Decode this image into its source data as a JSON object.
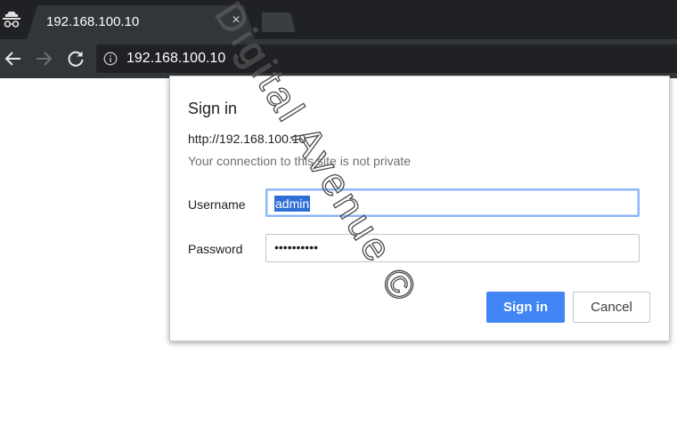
{
  "browser": {
    "tab": {
      "title": "192.168.100.10",
      "close_glyph": "×"
    },
    "toolbar": {
      "url": "192.168.100.10"
    }
  },
  "dialog": {
    "title": "Sign in",
    "site_url": "http://192.168.100.10",
    "warning": "Your connection to this site is not private",
    "username_label": "Username",
    "username_value": "admin",
    "password_label": "Password",
    "password_mask": "••••••••••",
    "signin_label": "Sign in",
    "cancel_label": "Cancel"
  },
  "watermark": {
    "text": "Digital Avenue ©"
  },
  "colors": {
    "tab_strip": "#1f2124",
    "toolbar": "#323639",
    "primary_button": "#4285f4",
    "focus_ring": "#8ab4f8"
  }
}
